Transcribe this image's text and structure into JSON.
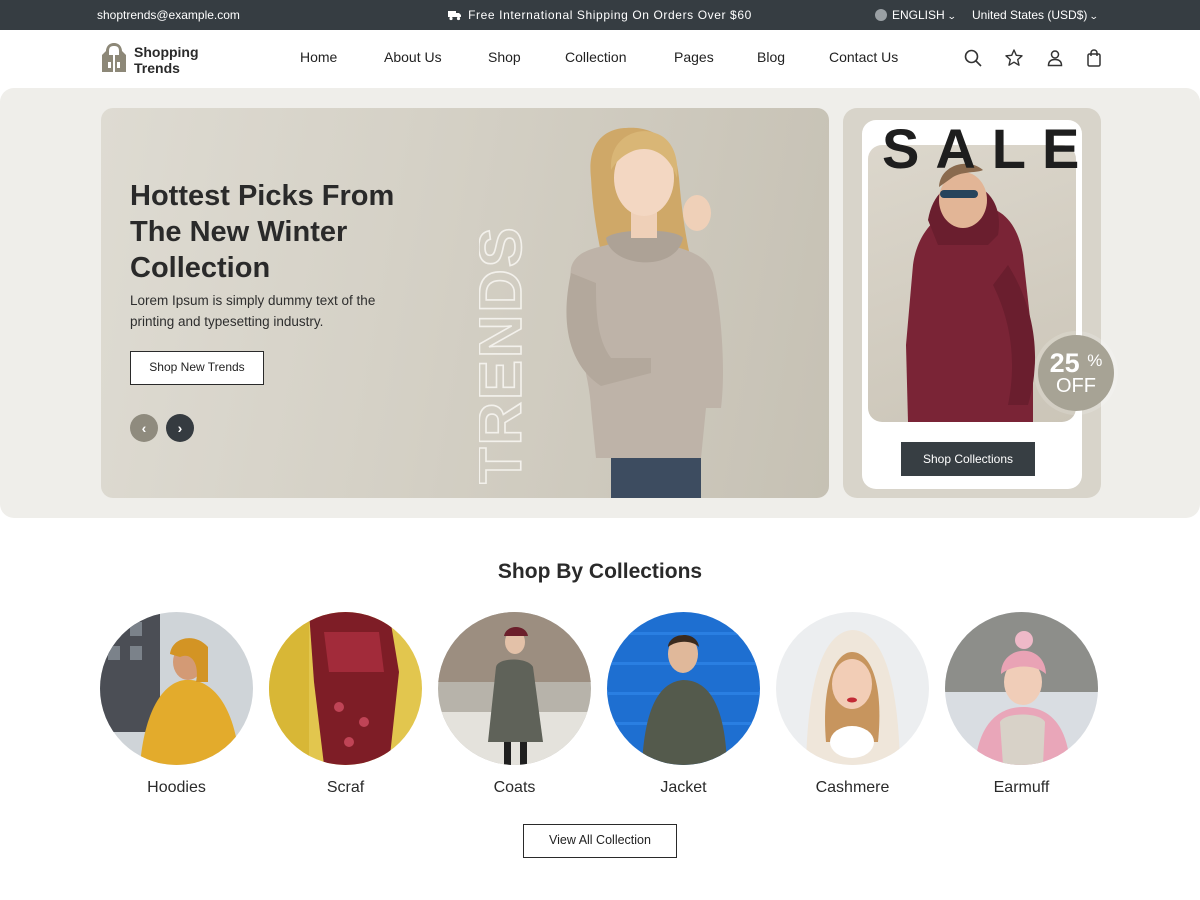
{
  "topbar": {
    "email": "shoptrends@example.com",
    "promo": "Free International Shipping On Orders Over $60",
    "language": "ENGLISH",
    "currency": "United States (USD$)"
  },
  "header": {
    "logo_line1": "Shopping",
    "logo_line2": "Trends",
    "nav": [
      "Home",
      "About Us",
      "Shop",
      "Collection",
      "Pages",
      "Blog",
      "Contact Us"
    ],
    "icons": [
      "search-icon",
      "star-icon",
      "user-icon",
      "bag-icon"
    ]
  },
  "hero": {
    "title": "Hottest Picks From The New Winter Collection",
    "subtitle": "Lorem Ipsum is simply dummy text of the printing and typesetting industry.",
    "button": "Shop New Trends",
    "backdrop_word": "TRENDS"
  },
  "sale": {
    "word": "SALE",
    "discount": "25",
    "percent_sign": "%",
    "off": "OFF",
    "button": "Shop Collections"
  },
  "collections": {
    "title": "Shop By Collections",
    "items": [
      {
        "name": "Hoodies",
        "color": "#e3ab2c"
      },
      {
        "name": "Scraf",
        "color": "#7e1d26"
      },
      {
        "name": "Coats",
        "color": "#5f6259"
      },
      {
        "name": "Jacket",
        "color": "#1e6fd1"
      },
      {
        "name": "Cashmere",
        "color": "#efe6da"
      },
      {
        "name": "Earmuff",
        "color": "#e9a6b9"
      }
    ],
    "view_all": "View All Collection"
  },
  "colors": {
    "dark": "#363d42",
    "hero_bg": "#efeeea",
    "accent_taupe": "#a7a395"
  }
}
